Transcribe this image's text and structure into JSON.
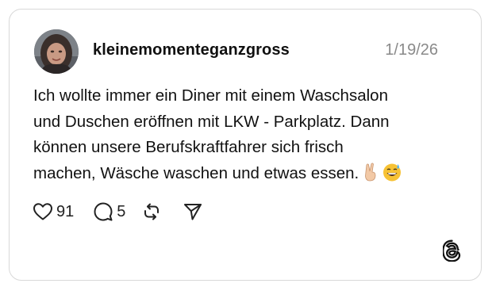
{
  "post": {
    "username": "kleinemomenteganzgross",
    "date": "1/19/26",
    "text_lines": [
      "Ich wollte immer ein Diner mit einem Waschsalon",
      "und Duschen eröffnen mit LKW - Parkplatz. Dann",
      "können unsere Berufskraftfahrer sich frisch",
      "machen, Wäsche waschen und etwas essen."
    ],
    "emojis": [
      "victory-hand-emoji",
      "grinning-sweat-emoji"
    ]
  },
  "actions": {
    "like_icon": "heart-icon",
    "like_count": "91",
    "reply_icon": "comment-icon",
    "reply_count": "5",
    "repost_icon": "repost-icon",
    "share_icon": "send-icon"
  },
  "brand": {
    "logo": "threads-logo-icon"
  },
  "colors": {
    "border": "#d8d8d8",
    "text": "#111111",
    "muted": "#8a8a8a"
  }
}
